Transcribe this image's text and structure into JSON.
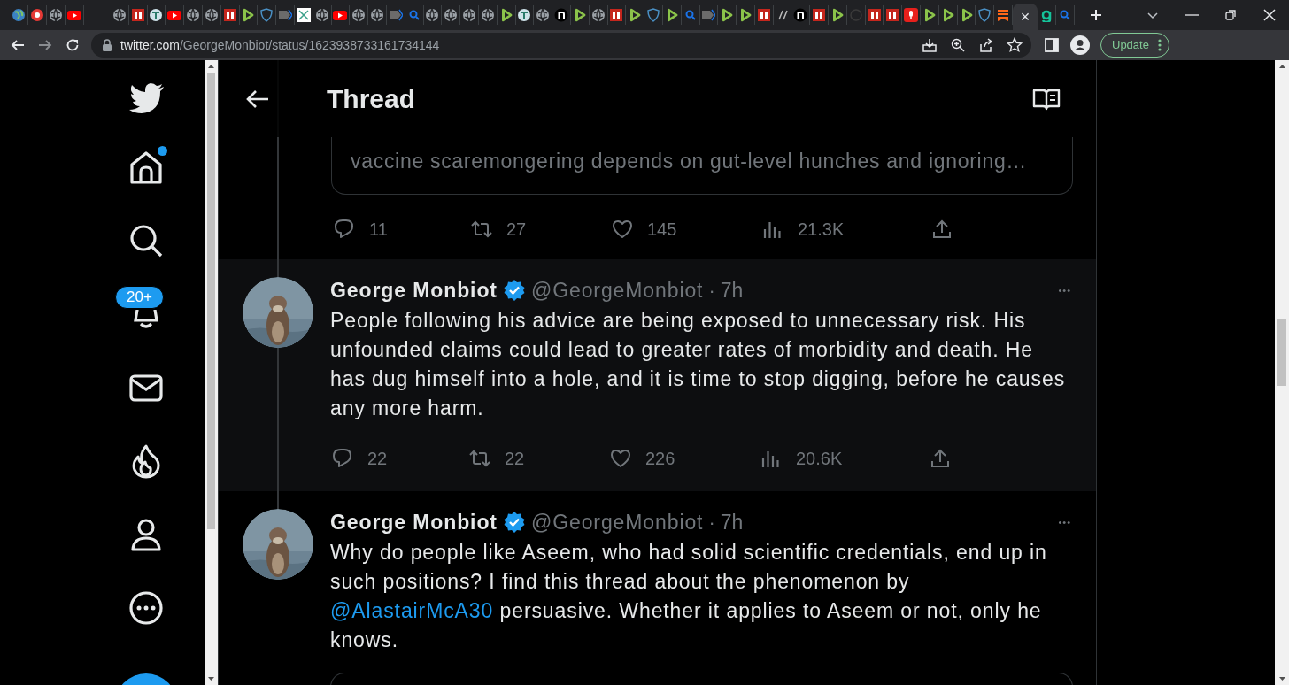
{
  "browser": {
    "tabs": [
      {
        "kind": "earth",
        "selected": false
      },
      {
        "kind": "pinwheel",
        "selected": false
      },
      {
        "kind": "globe",
        "selected": false
      },
      {
        "kind": "youtube",
        "selected": false
      },
      {
        "kind": "globe",
        "selected": false
      },
      {
        "kind": "bi",
        "selected": false
      },
      {
        "kind": "tree",
        "selected": false
      },
      {
        "kind": "youtube",
        "selected": false
      },
      {
        "kind": "globe",
        "selected": false
      },
      {
        "kind": "globe",
        "selected": false
      },
      {
        "kind": "bi",
        "selected": false
      },
      {
        "kind": "play",
        "selected": false
      },
      {
        "kind": "shield",
        "selected": false
      },
      {
        "kind": "tag",
        "selected": false
      },
      {
        "kind": "grid",
        "selected": false
      },
      {
        "kind": "globe",
        "selected": false
      },
      {
        "kind": "youtube",
        "selected": false
      },
      {
        "kind": "globe",
        "selected": false
      },
      {
        "kind": "globe",
        "selected": false
      },
      {
        "kind": "tag",
        "selected": false
      },
      {
        "kind": "search",
        "selected": false
      },
      {
        "kind": "globe",
        "selected": false
      },
      {
        "kind": "globe",
        "selected": false
      },
      {
        "kind": "globe",
        "selected": false
      },
      {
        "kind": "globe",
        "selected": false
      },
      {
        "kind": "play",
        "selected": false
      },
      {
        "kind": "tree",
        "selected": false
      },
      {
        "kind": "globe",
        "selected": false
      },
      {
        "kind": "n",
        "selected": false
      },
      {
        "kind": "play",
        "selected": false
      },
      {
        "kind": "globe",
        "selected": false
      },
      {
        "kind": "bi",
        "selected": false
      },
      {
        "kind": "play",
        "selected": false
      },
      {
        "kind": "shield",
        "selected": false
      },
      {
        "kind": "play",
        "selected": false
      },
      {
        "kind": "search",
        "selected": false
      },
      {
        "kind": "tag",
        "selected": false
      },
      {
        "kind": "play",
        "selected": false
      },
      {
        "kind": "play",
        "selected": false
      },
      {
        "kind": "bi",
        "selected": false
      },
      {
        "kind": "slash",
        "selected": false
      },
      {
        "kind": "n",
        "selected": false
      },
      {
        "kind": "bi",
        "selected": false
      },
      {
        "kind": "play",
        "selected": false
      },
      {
        "kind": "blank",
        "selected": false
      },
      {
        "kind": "bi",
        "selected": false
      },
      {
        "kind": "bi",
        "selected": false
      },
      {
        "kind": "mic",
        "selected": false
      },
      {
        "kind": "play",
        "selected": false
      },
      {
        "kind": "play",
        "selected": false
      },
      {
        "kind": "play",
        "selected": false
      },
      {
        "kind": "shield",
        "selected": false
      },
      {
        "kind": "bookmark",
        "selected": false
      },
      {
        "selected": true
      },
      {
        "kind": "g",
        "selected": false
      },
      {
        "kind": "search",
        "selected": false
      }
    ],
    "close_tab": "×",
    "address": {
      "host": "twitter.com",
      "path": "/GeorgeMonbiot/status/1623938733161734144"
    },
    "update_button": "Update"
  },
  "sidebar": {
    "items": [
      {
        "kind": "bird"
      },
      {
        "kind": "home",
        "dot": true
      },
      {
        "kind": "search"
      },
      {
        "kind": "bell",
        "badge": "20+"
      },
      {
        "kind": "mail"
      },
      {
        "kind": "flame"
      },
      {
        "kind": "person"
      },
      {
        "kind": "more"
      },
      {
        "kind": "compose"
      }
    ]
  },
  "header": {
    "title": "Thread"
  },
  "card_tail": {
    "text": "vaccine scaremongering depends on gut-level hunches and ignoring…",
    "actions": [
      {
        "kind": "reply",
        "count": "11"
      },
      {
        "kind": "retweet",
        "count": "27"
      },
      {
        "kind": "like",
        "count": "145"
      },
      {
        "kind": "views",
        "count": "21.3K"
      },
      {
        "kind": "share"
      }
    ]
  },
  "tweets": [
    {
      "author": "George Monbiot",
      "verified": true,
      "handle": "@GeorgeMonbiot",
      "separator": "·",
      "time": "7h",
      "more": "•••",
      "hovered": true,
      "text": [
        {
          "kind": "plain",
          "text": "People following his advice are being exposed to unnecessary risk. His unfounded claims could lead to greater rates of morbidity and death. He has dug himself into a hole, and it is time to stop digging, before he causes any more harm."
        }
      ],
      "actions": [
        {
          "kind": "reply",
          "count": "22"
        },
        {
          "kind": "retweet",
          "count": "22"
        },
        {
          "kind": "like",
          "count": "226"
        },
        {
          "kind": "views",
          "count": "20.6K"
        },
        {
          "kind": "share"
        }
      ]
    },
    {
      "author": "George Monbiot",
      "verified": true,
      "handle": "@GeorgeMonbiot",
      "separator": "·",
      "time": "7h",
      "more": "•••",
      "hovered": false,
      "text": [
        {
          "kind": "plain",
          "text": "Why do people like Aseem, who had solid scientific credentials, end up in such positions? I find this thread about the phenomenon by "
        },
        {
          "kind": "mention",
          "text": "@AlastairMcA30"
        },
        {
          "kind": "plain",
          "text": " persuasive. Whether it applies to Aseem or not, only he knows."
        }
      ],
      "card_below": true
    }
  ]
}
